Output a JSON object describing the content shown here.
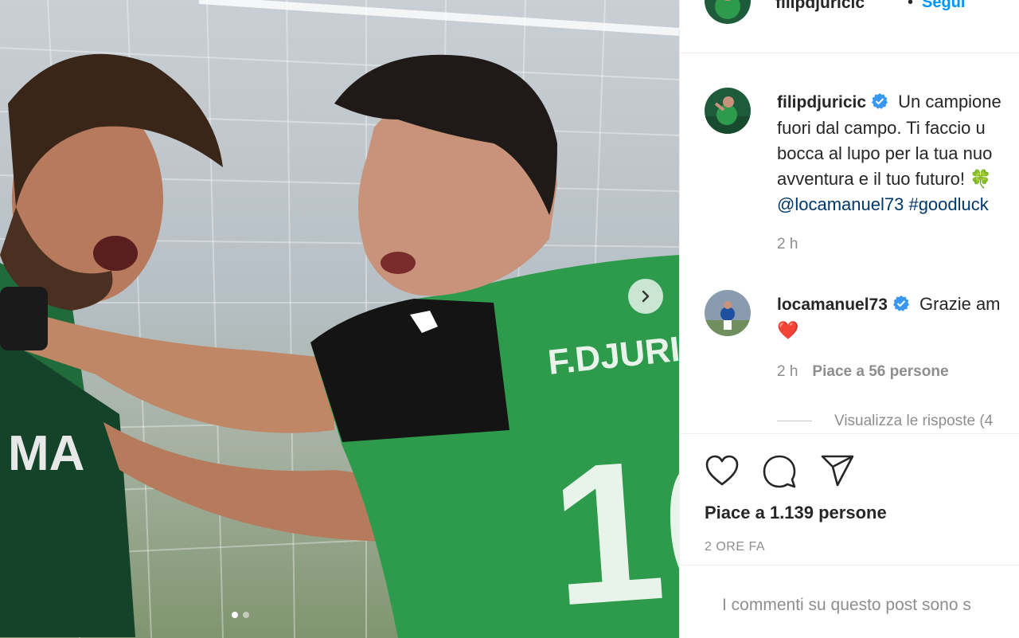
{
  "post": {
    "photo_alt": "",
    "carousel": {
      "slides": 2,
      "active_slide": 1
    }
  },
  "header": {
    "username": "filipdjuricic",
    "bullet": "•",
    "follow_label": "Segui"
  },
  "caption": {
    "username": "filipdjuricic",
    "line1": "Un campione",
    "line2": "fuori dal campo. Ti faccio u",
    "line3": "bocca al lupo per la tua nuo",
    "line4": "avventura e il tuo futuro! 🍀",
    "mention": "@locamanuel73",
    "hashtag": "#goodluck",
    "time": "2 h"
  },
  "comment": {
    "username": "locamanuel73",
    "text": "Grazie am",
    "emoji": "❤️",
    "time": "2 h",
    "likes": "Piace a 56 persone",
    "view_replies": "Visualizza le risposte (4"
  },
  "actions": {
    "like_icon": "heart-icon",
    "comment_icon": "comment-icon",
    "share_icon": "share-icon"
  },
  "likes_label": "Piace a 1.139 persone",
  "date_label": "2 ORE FA",
  "comments_disabled": "I commenti su questo post sono s",
  "colors": {
    "link": "#00376b",
    "follow": "#0095f6",
    "verified": "#3897f0",
    "muted": "#8e8e8e",
    "jersey_green": "#2e9a4c"
  }
}
